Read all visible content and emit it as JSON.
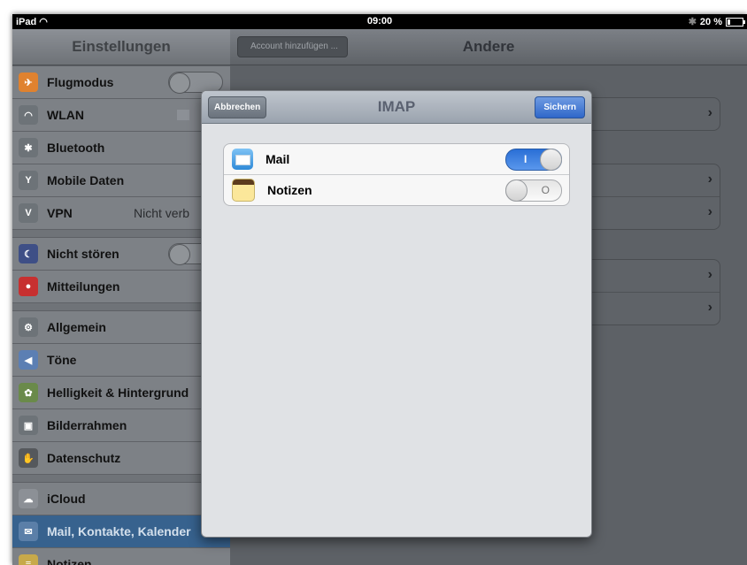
{
  "status_bar": {
    "device": "iPad",
    "time": "09:00",
    "battery": "20 %",
    "battery_level": 0.2
  },
  "sidebar": {
    "title": "Einstellungen",
    "groups": [
      [
        {
          "label": "Flugmodus",
          "icon": "airplane-icon",
          "color": "#e0822f"
        },
        {
          "label": "WLAN",
          "icon": "wifi-icon",
          "color": "#6d7378"
        },
        {
          "label": "Bluetooth",
          "icon": "bluetooth-icon",
          "color": "#6d7378"
        },
        {
          "label": "Mobile Daten",
          "icon": "antenna-icon",
          "color": "#6d7378"
        },
        {
          "label": "VPN",
          "icon": "vpn-icon",
          "color": "#6d7378",
          "value": "Nicht verb"
        }
      ],
      [
        {
          "label": "Nicht stören",
          "icon": "moon-icon",
          "color": "#3e4f86"
        },
        {
          "label": "Mitteilungen",
          "icon": "notification-icon",
          "color": "#c73030"
        }
      ],
      [
        {
          "label": "Allgemein",
          "icon": "gear-icon",
          "color": "#6d7378"
        },
        {
          "label": "Töne",
          "icon": "speaker-icon",
          "color": "#5c7fb3"
        },
        {
          "label": "Helligkeit & Hintergrund",
          "icon": "flower-icon",
          "color": "#6a8a4a"
        },
        {
          "label": "Bilderrahmen",
          "icon": "picture-frame-icon",
          "color": "#6d7378"
        },
        {
          "label": "Datenschutz",
          "icon": "hand-icon",
          "color": "#55585c"
        }
      ],
      [
        {
          "label": "iCloud",
          "icon": "cloud-icon",
          "color": "#8c9096"
        },
        {
          "label": "Mail, Kontakte, Kalender",
          "icon": "mail-icon",
          "color": "#5b7fa8",
          "selected": true
        },
        {
          "label": "Notizen",
          "icon": "notes-icon",
          "color": "#c7a94a"
        }
      ]
    ]
  },
  "right_pane": {
    "back_label": "Account hinzufügen ...",
    "title": "Andere"
  },
  "modal": {
    "cancel_label": "Abbrechen",
    "title": "IMAP",
    "save_label": "Sichern",
    "rows": [
      {
        "label": "Mail",
        "icon": "mail-icon",
        "on": true,
        "toggle_text": "I"
      },
      {
        "label": "Notizen",
        "icon": "notes-icon",
        "on": false,
        "toggle_text": "O"
      }
    ]
  }
}
